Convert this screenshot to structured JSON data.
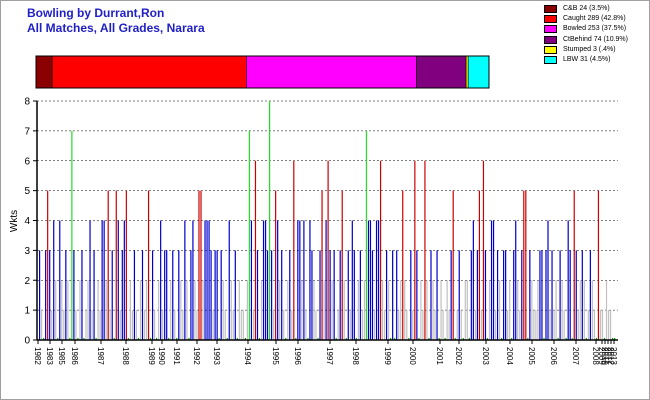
{
  "title_line1": "Bowling by Durrant,Ron",
  "title_line2": "All Matches, All Grades, Narara",
  "chart_data": {
    "type": "bar",
    "ylabel": "Wkts",
    "ylim": [
      0,
      8
    ],
    "yticks": [
      "0",
      "1",
      "2",
      "3",
      "4",
      "5",
      "6",
      "7",
      "8"
    ],
    "grid": "horizontal dashed",
    "legend_placement": "top-right",
    "dismissal_breakdown": [
      {
        "label": "C&B 24 (3.5%)",
        "value": 24,
        "color": "#8b0000"
      },
      {
        "label": "Caught 289 (42.8%)",
        "value": 289,
        "color": "#ff0000"
      },
      {
        "label": "Bowled 253 (37.5%)",
        "value": 253,
        "color": "#ff00ff"
      },
      {
        "label": "CtBehind 74 (10.9%)",
        "value": 74,
        "color": "#800080"
      },
      {
        "label": "Stumped 3 (.4%)",
        "value": 3,
        "color": "#ffff00"
      },
      {
        "label": "LBW 31 (4.5%)",
        "value": 31,
        "color": "#00ffff"
      }
    ],
    "x_categories": [
      "1982",
      "1983",
      "1985",
      "1986",
      "1987",
      "1988",
      "1989",
      "1990",
      "1991",
      "1992",
      "1993",
      "1994",
      "1995",
      "1996",
      "1997",
      "1998",
      "1999",
      "2000",
      "2001",
      "2002",
      "2003",
      "2004",
      "2005",
      "2006",
      "2007",
      "2008",
      "2009",
      "2010",
      "2011",
      "2012",
      "2013"
    ],
    "color_scale": {
      "0": "#c0c0c0",
      "1": "#c0c0c0",
      "2": "#c0c0c0",
      "3": "#0000cc",
      "4": "#0000cc",
      "5": "#cc0000",
      "6": "#cc0000",
      "7": "#22dd22",
      "8": "#22dd22"
    },
    "match_wickets": [
      3,
      1,
      0,
      3,
      5,
      3,
      1,
      4,
      2,
      0,
      4,
      2,
      1,
      3,
      2,
      0,
      7,
      3,
      1,
      0,
      2,
      3,
      0,
      1,
      2,
      4,
      1,
      3,
      0,
      2,
      1,
      4,
      4,
      2,
      5,
      1,
      3,
      0,
      5,
      4,
      1,
      3,
      4,
      5,
      0,
      2,
      1,
      3,
      1,
      0,
      2,
      3,
      1,
      2,
      5,
      0,
      3,
      1,
      0,
      2,
      4,
      1,
      3,
      3,
      0,
      2,
      3,
      1,
      0,
      3,
      2,
      1,
      4,
      2,
      0,
      3,
      4,
      2,
      1,
      5,
      5,
      2,
      4,
      4,
      4,
      3,
      1,
      3,
      3,
      0,
      3,
      2,
      1,
      0,
      4,
      2,
      1,
      3,
      0,
      2,
      1,
      1,
      0,
      2,
      7,
      4,
      1,
      6,
      3,
      0,
      2,
      4,
      4,
      3,
      8,
      3,
      1,
      5,
      4,
      2,
      3,
      1,
      0,
      2,
      3,
      1,
      6,
      0,
      4,
      4,
      2,
      4,
      1,
      0,
      4,
      3,
      2,
      1,
      0,
      3,
      5,
      2,
      4,
      6,
      3,
      2,
      3,
      0,
      1,
      3,
      5,
      2,
      0,
      3,
      1,
      4,
      3,
      0,
      2,
      3,
      1,
      2,
      7,
      4,
      4,
      3,
      1,
      4,
      4,
      6,
      2,
      1,
      3,
      2,
      0,
      3,
      0,
      3,
      1,
      2,
      5,
      2,
      1,
      0,
      3,
      1,
      6,
      3,
      0,
      2,
      1,
      6,
      2,
      0,
      3,
      2,
      1,
      3,
      0,
      2,
      1,
      0,
      2,
      1,
      3,
      5,
      0,
      1,
      3,
      1,
      0,
      2,
      2,
      0,
      3,
      4,
      1,
      3,
      5,
      1,
      6,
      3,
      0,
      2,
      4,
      4,
      1,
      3,
      2,
      0,
      3,
      3,
      1,
      2,
      0,
      3,
      4,
      2,
      1,
      3,
      5,
      5,
      0,
      3,
      2,
      1,
      1,
      2,
      3,
      3,
      0,
      3,
      4,
      1,
      3,
      1,
      2,
      0,
      3,
      2,
      1,
      0,
      4,
      3,
      0,
      5,
      3,
      1,
      2,
      3,
      2,
      0,
      1,
      3,
      2,
      1,
      0,
      5,
      1,
      1,
      0,
      2,
      1,
      1,
      0,
      0
    ]
  }
}
